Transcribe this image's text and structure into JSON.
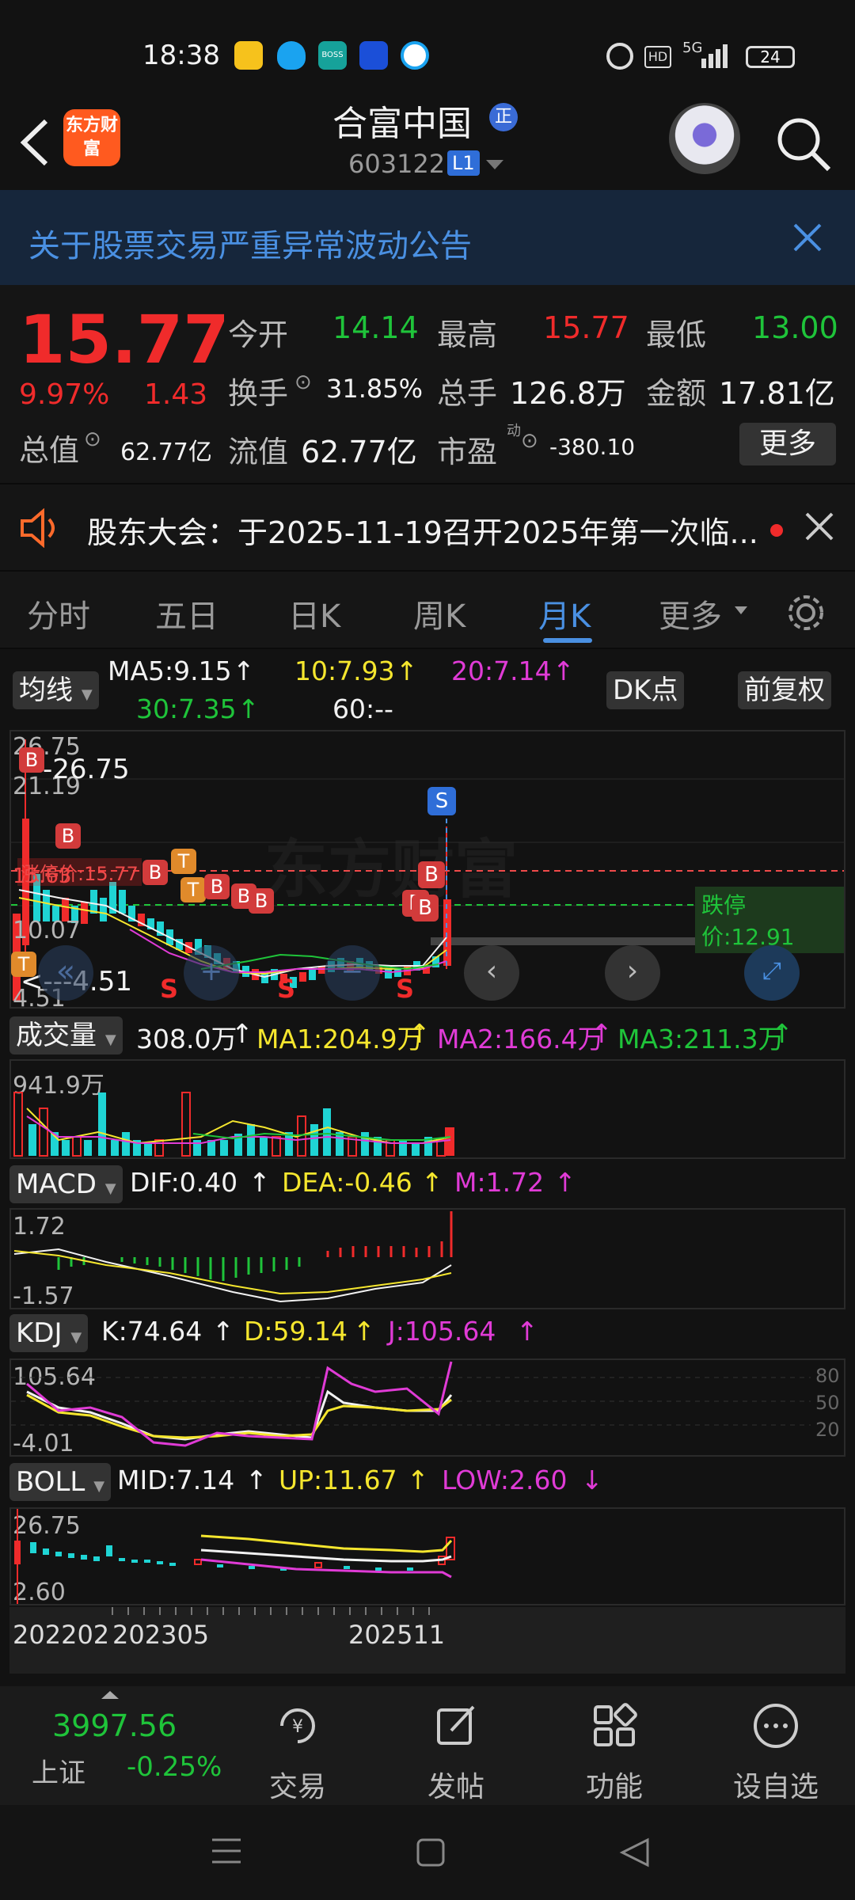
{
  "status_bar": {
    "time": "18:38",
    "network": "5G",
    "battery": "24",
    "apps": [
      "mail-icon",
      "qq-icon",
      "boss-icon",
      "recruit-icon",
      "browser-icon"
    ]
  },
  "header": {
    "app_logo": "东方财富",
    "stock_name": "合富中国",
    "badge": "正",
    "code": "603122",
    "level": "L1"
  },
  "notice": {
    "text": "关于股票交易严重异常波动公告"
  },
  "quote": {
    "price": "15.77",
    "change_pct": "9.97%",
    "change_abs": "1.43",
    "market_cap_label": "总值",
    "market_cap": "62.77亿",
    "open_label": "今开",
    "open": "14.14",
    "high_label": "最高",
    "high": "15.77",
    "low_label": "最低",
    "low": "13.00",
    "turnover_label": "换手",
    "turnover": "31.85%",
    "volume_label": "总手",
    "volume": "126.8万",
    "amount_label": "金额",
    "amount": "17.81亿",
    "float_cap_label": "流值",
    "float_cap": "62.77亿",
    "pe_label": "市盈",
    "pe_sup": "动",
    "pe": "-380.10",
    "more": "更多"
  },
  "announcement": {
    "text": "股东大会：于2025-11-19召开2025年第一次临..."
  },
  "tabs": [
    "分时",
    "五日",
    "日K",
    "周K",
    "月K",
    "更多"
  ],
  "active_tab": "月K",
  "ma": {
    "selector": "均线",
    "ma5": "MA5:9.15",
    "ma10": "10:7.93",
    "ma20": "20:7.14",
    "ma30": "30:7.35",
    "ma60": "60:--",
    "dk": "DK点",
    "adjust": "前复权"
  },
  "kline": {
    "max_label": "26.75",
    "max_marker": "26.75",
    "y_ticks": [
      "21.19",
      "15.63",
      "10.07",
      "4.51"
    ],
    "min_marker": "4.51",
    "limit_up": "涨停价:15.77",
    "limit_down": "跌停价:12.91",
    "watermark": "东方财富"
  },
  "volume_panel": {
    "selector": "成交量",
    "vol": "308.0万",
    "ma1": "MA1:204.9万",
    "ma2": "MA2:166.4万",
    "ma3": "MA3:211.3万",
    "max": "941.9万"
  },
  "macd_panel": {
    "selector": "MACD",
    "dif": "DIF:0.40",
    "dea": "DEA:-0.46",
    "m": "M:1.72",
    "max": "1.72",
    "min": "-1.57"
  },
  "kdj_panel": {
    "selector": "KDJ",
    "k": "K:74.64",
    "d": "D:59.14",
    "j": "J:105.64",
    "max": "105.64",
    "min": "-4.01",
    "levels": [
      "80",
      "50",
      "20"
    ]
  },
  "boll_panel": {
    "selector": "BOLL",
    "mid": "MID:7.14",
    "up": "UP:11.67",
    "low": "LOW:2.60",
    "max": "26.75",
    "min": "2.60"
  },
  "x_axis": [
    "202202",
    "202305",
    "202511"
  ],
  "bottom_bar": {
    "index_value": "3997.56",
    "index_name": "上证",
    "index_change": "-0.25%",
    "items": [
      "交易",
      "发帖",
      "功能",
      "设自选"
    ]
  },
  "colors": {
    "up": "#f02b2b",
    "down": "#1fc43a",
    "accent": "#4a90e2",
    "ma5": "#f2f2f2",
    "ma10": "#f5e62e",
    "ma20": "#e03bd6",
    "ma30": "#1fc43a"
  }
}
